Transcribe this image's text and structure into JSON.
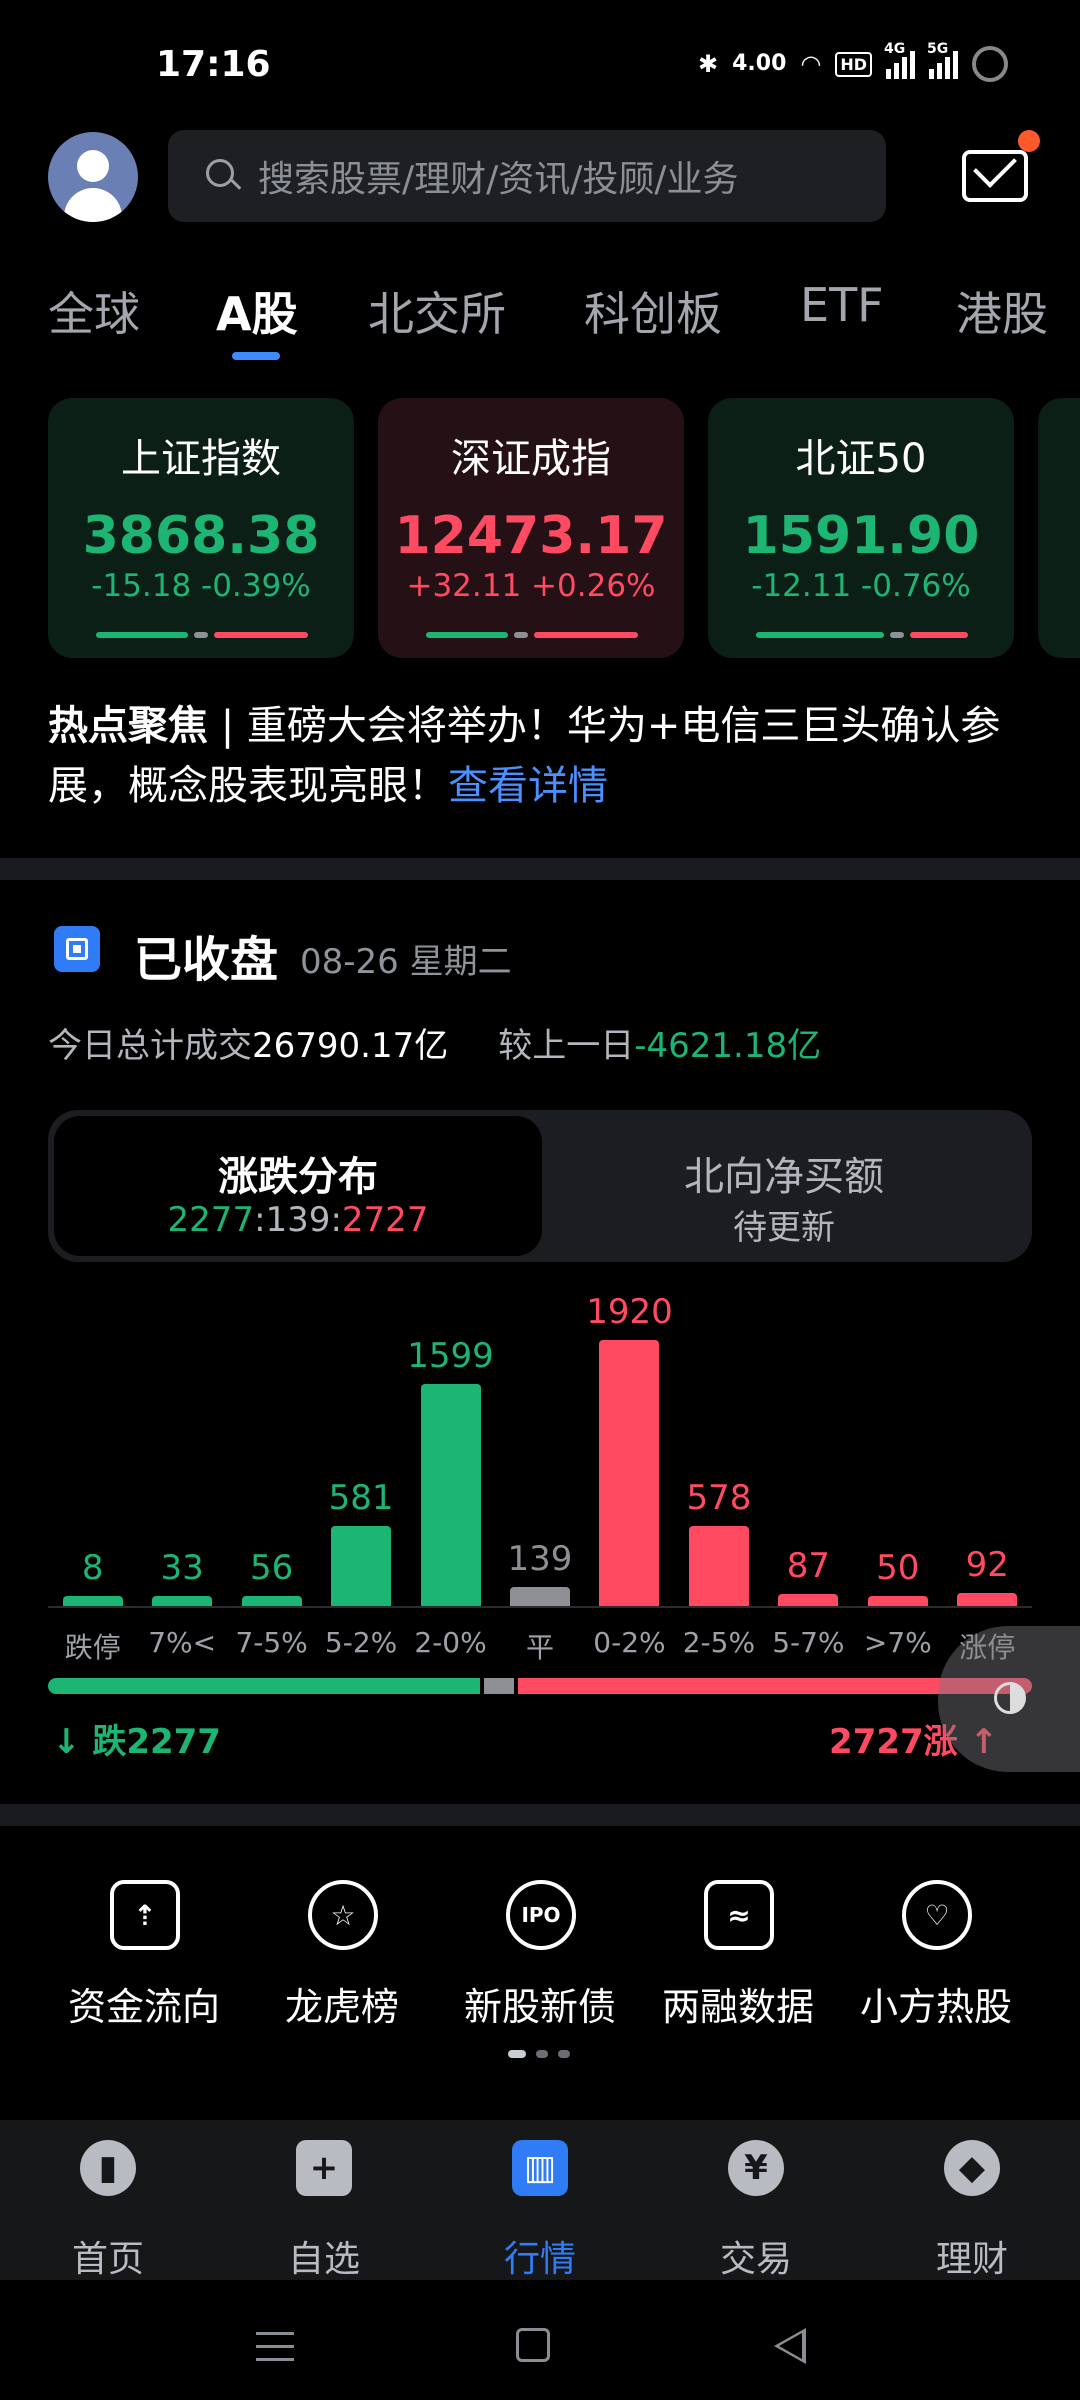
{
  "status_bar": {
    "time": "17:16",
    "speed": "4.00",
    "hd": "HD",
    "sig1": "4G",
    "sig2": "5G"
  },
  "search": {
    "placeholder": "搜索股票/理财/资讯/投顾/业务"
  },
  "tabs": [
    {
      "label": "全球"
    },
    {
      "label": "A股"
    },
    {
      "label": "北交所"
    },
    {
      "label": "科创板"
    },
    {
      "label": "ETF"
    },
    {
      "label": "港股"
    }
  ],
  "indices": [
    {
      "name": "上证指数",
      "value": "3868.38",
      "change": "-15.18 -0.39%"
    },
    {
      "name": "深证成指",
      "value": "12473.17",
      "change": "+32.11 +0.26%"
    },
    {
      "name": "北证50",
      "value": "1591.90",
      "change": "-12.11 -0.76%"
    }
  ],
  "hot_news": {
    "tag": "热点聚焦",
    "separator": " | ",
    "text": "重磅大会将举办！华为+电信三巨头确认参展，概念股表现亮眼！",
    "link": "查看详情"
  },
  "market_status": {
    "title": "已收盘",
    "date": "08-26 星期二",
    "volume_label": "今日总计成交",
    "volume_value": "26790.17亿",
    "compare_label": "较上一日",
    "compare_value": "-4621.18亿"
  },
  "toggle": {
    "left_title": "涨跌分布",
    "fall": "2277",
    "colon1": ":",
    "flat": "139",
    "colon2": ":",
    "rise": "2727",
    "right_title": "北向净买额",
    "right_sub": "待更新"
  },
  "chart_data": {
    "type": "bar",
    "categories": [
      "跌停",
      "7%<",
      "7-5%",
      "5-2%",
      "2-0%",
      "平",
      "0-2%",
      "2-5%",
      "5-7%",
      ">7%",
      "涨停"
    ],
    "values": [
      8,
      33,
      56,
      581,
      1599,
      139,
      1920,
      578,
      87,
      50,
      92
    ],
    "colors": [
      "#1db573",
      "#1db573",
      "#1db573",
      "#1db573",
      "#1db573",
      "#8e9096",
      "#ff4a62",
      "#ff4a62",
      "#ff4a62",
      "#ff4a62",
      "#ff4a62"
    ],
    "ylim": [
      0,
      1920
    ]
  },
  "summary": {
    "fall_label": "跌2277",
    "rise_label": "2727涨",
    "fall_count": 2277,
    "flat_count": 139,
    "rise_count": 2727
  },
  "shortcuts": [
    {
      "label": "资金流向",
      "icon": "money-flow-icon"
    },
    {
      "label": "龙虎榜",
      "icon": "star-badge-icon"
    },
    {
      "label": "新股新债",
      "icon": "ipo-icon",
      "glyph": "IPO"
    },
    {
      "label": "两融数据",
      "icon": "margin-data-icon"
    },
    {
      "label": "小方热股",
      "icon": "heart-chat-icon"
    }
  ],
  "bottom_nav": [
    {
      "label": "首页",
      "icon": "home-icon"
    },
    {
      "label": "自选",
      "icon": "plus-icon",
      "glyph": "+"
    },
    {
      "label": "行情",
      "icon": "market-chart-icon"
    },
    {
      "label": "交易",
      "icon": "yen-icon",
      "glyph": "¥"
    },
    {
      "label": "理财",
      "icon": "diamond-icon"
    }
  ],
  "colors": {
    "rise": "#ff4a62",
    "fall": "#1db573",
    "flat": "#8e9096",
    "accent": "#2f7cf6"
  }
}
